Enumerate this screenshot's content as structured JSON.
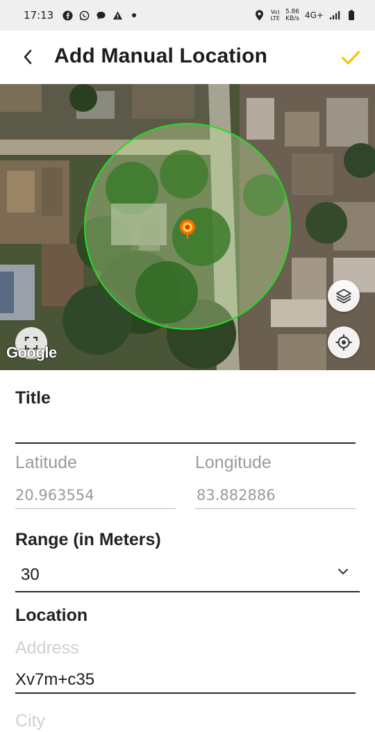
{
  "status_bar": {
    "time": "17:13",
    "volte_top": "Vo)",
    "volte_bottom": "LTE",
    "speed_value": "5.86",
    "speed_unit": "KB/s",
    "network": "4G+"
  },
  "app_bar": {
    "title": "Add Manual Location",
    "back_icon": "chevron-left-icon",
    "confirm_icon": "check-icon",
    "accent_color": "#f5c400"
  },
  "map": {
    "attribution": "Google",
    "circle_color": "#22dd22",
    "marker_color": "#ff6a00",
    "layers_icon": "layers-icon",
    "locate_icon": "my-location-icon",
    "fullscreen_icon": "fullscreen-icon"
  },
  "form": {
    "title_label": "Title",
    "title_value": "",
    "latitude_label": "Latitude",
    "latitude_value": "20.963554",
    "longitude_label": "Longitude",
    "longitude_value": "83.882886",
    "range_label": "Range (in Meters)",
    "range_value": "30",
    "location_label": "Location",
    "address_placeholder": "Address",
    "address_value": "Xv7m+c35",
    "city_placeholder": "City"
  }
}
